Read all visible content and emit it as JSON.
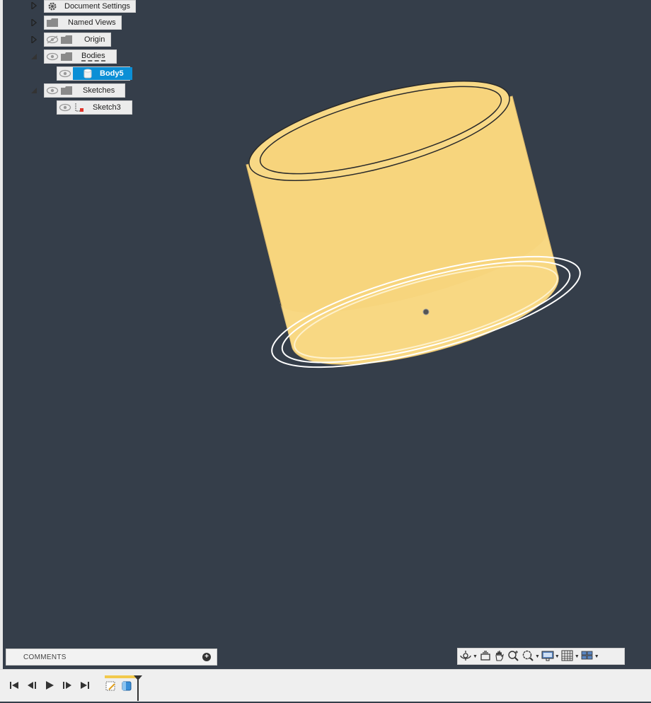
{
  "browser": {
    "items": [
      {
        "label": "Document Settings",
        "icon": "gear-icon",
        "expander": "collapsed"
      },
      {
        "label": "Named Views",
        "icon": "folder-icon",
        "expander": "collapsed"
      },
      {
        "label": "Origin",
        "icon": "folder-icon",
        "visibility": "hidden",
        "expander": "collapsed"
      },
      {
        "label": "Bodies",
        "icon": "folder-icon",
        "visibility": "visible",
        "expander": "expanded"
      },
      {
        "label": "Body5",
        "icon": "body-icon",
        "visibility": "visible",
        "selected": true
      },
      {
        "label": "Sketches",
        "icon": "folder-icon",
        "visibility": "visible",
        "expander": "expanded"
      },
      {
        "label": "Sketch3",
        "icon": "sketch-icon",
        "visibility": "visible"
      }
    ]
  },
  "comments": {
    "label": "COMMENTS"
  },
  "navigation_toolbar": {
    "tools": [
      "orbit-icon",
      "look-at-icon",
      "pan-icon",
      "zoom-icon",
      "fit-icon",
      "display-settings-icon",
      "grid-icon",
      "viewports-icon"
    ]
  },
  "timeline": {
    "controls": [
      "go-to-start",
      "step-back",
      "play",
      "step-forward",
      "go-to-end"
    ],
    "features": [
      "sketch-feature",
      "extrude-feature"
    ]
  },
  "colors": {
    "viewport_bg": "#353e4a",
    "body_fill": "#f7d57d",
    "selection_blue": "#0b8fd6",
    "panel_bg": "#ececec"
  }
}
